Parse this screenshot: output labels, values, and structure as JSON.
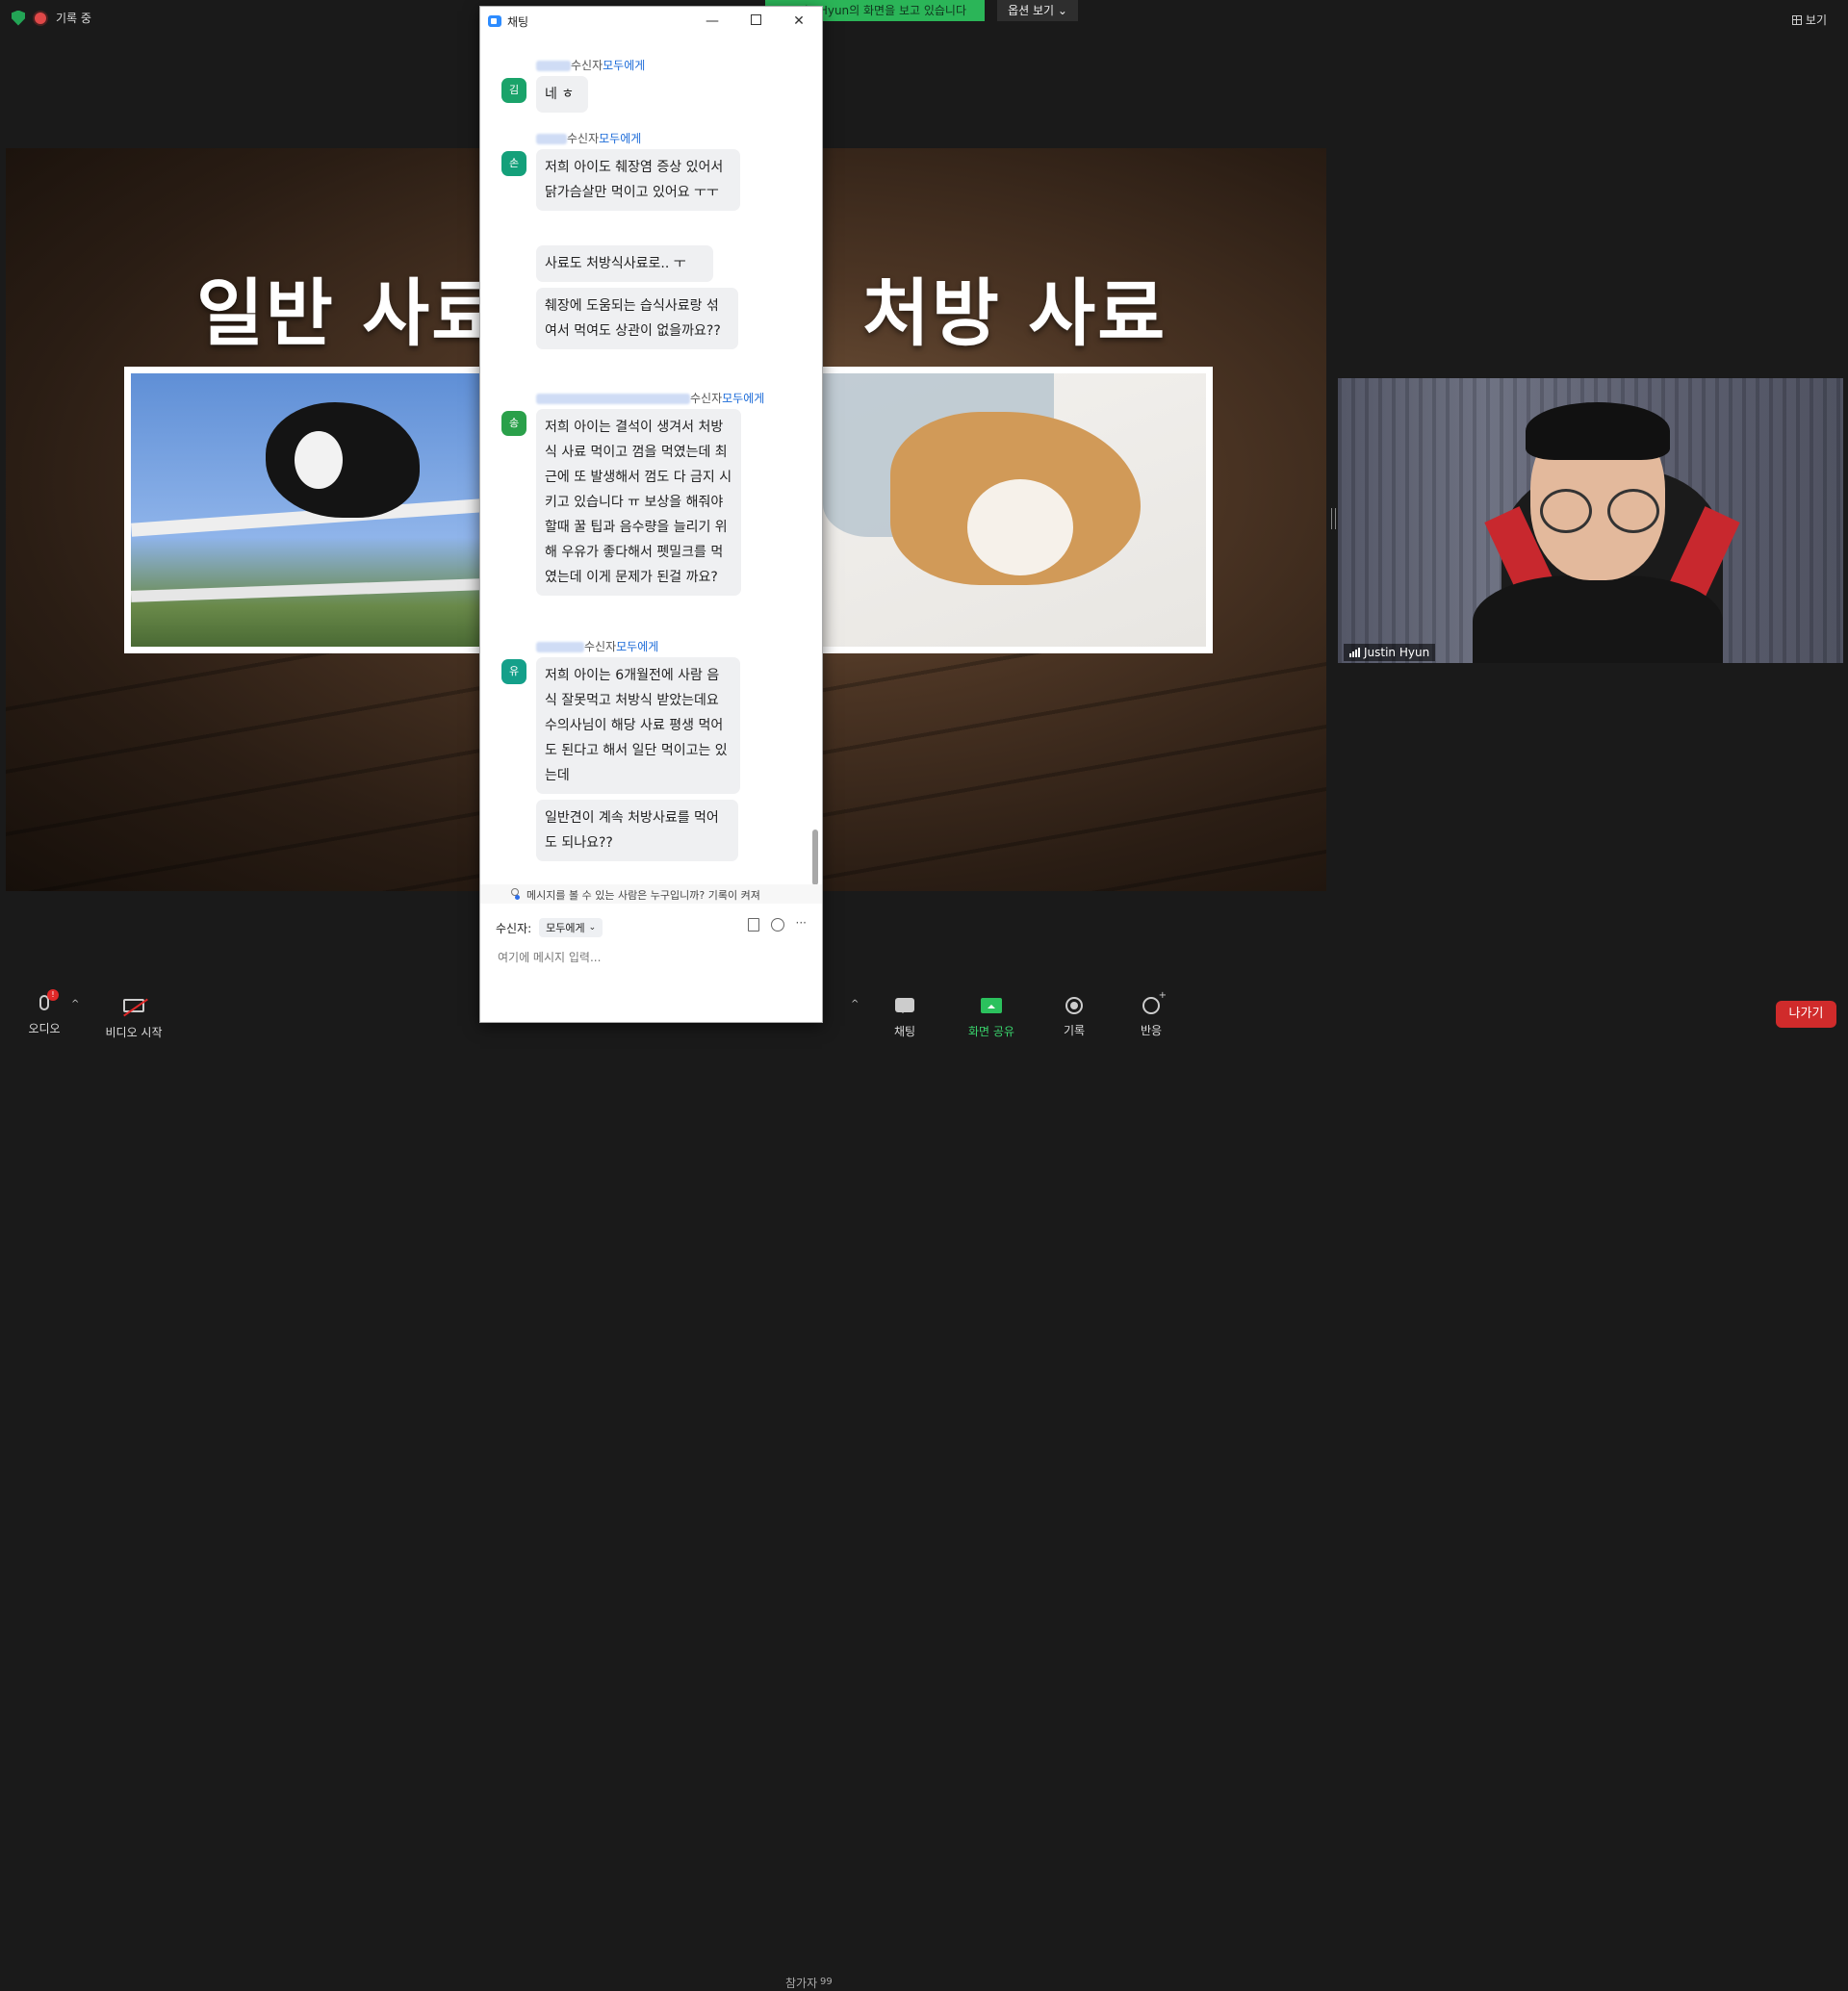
{
  "topbar": {
    "recording_label": "기록 중",
    "share_banner": "Justin Hyun의 화면을 보고 있습니다",
    "view_options_label": "옵션 보기",
    "view_label": "보기"
  },
  "slide": {
    "left_title": "일반 사료",
    "right_title": "처방 사료"
  },
  "video": {
    "participant_name": "Justin Hyun"
  },
  "chat": {
    "window_title": "채팅",
    "to_label": "수신자",
    "to_all": "모두에게",
    "messages": [
      {
        "avatar": "김",
        "lines": [
          "네 ㅎ"
        ]
      },
      {
        "avatar": "손",
        "lines": [
          "저희 아이도 췌장염 증상 있어서 닭가슴살만 먹이고 있어요 ㅜㅜ",
          "사료도 처방식사료로.. ㅜ",
          "췌장에 도움되는 습식사료랑 섞여서 먹여도 상관이 없을까요??"
        ]
      },
      {
        "avatar": "송",
        "lines": [
          "저희 아이는 결석이 생겨서 처방식 사료 먹이고 껌을 먹였는데 최근에 또 발생해서 껌도 다 금지 시키고 있습니다 ㅠ 보상을 해줘야 할때 꿀 팁과 음수량을 늘리기 위해 우유가 좋다해서 펫밀크를 먹였는데 이게 문제가 된걸 까요?"
        ]
      },
      {
        "avatar": "유",
        "lines": [
          "저희 아이는 6개월전에 사람 음식 잘못먹고 처방식 받았는데요 수의사님이 해당 사료 평생 먹어도 된다고 해서 일단 먹이고는 있는데",
          "일반견이 계속 처방사료를 먹어도 되나요??"
        ]
      }
    ],
    "info_text": "메시지를 볼 수 있는 사람은 누구입니까? 기록이 켜져",
    "recipient_label": "수신자:",
    "recipient_value": "모두에게",
    "input_placeholder": "여기에 메시지 입력..."
  },
  "toolbar": {
    "audio_label": "오디오",
    "audio_badge": "!",
    "video_label": "비디오 시작",
    "participants_label": "참가자",
    "participants_count": "99",
    "chat_label": "채팅",
    "share_label": "화면 공유",
    "record_label": "기록",
    "reactions_label": "반응",
    "leave_label": "나가기"
  },
  "colors": {
    "share_green": "#2bb558",
    "leave_red": "#d02b2b",
    "zoom_blue": "#2d8cff",
    "link_blue": "#1a6ad8"
  }
}
